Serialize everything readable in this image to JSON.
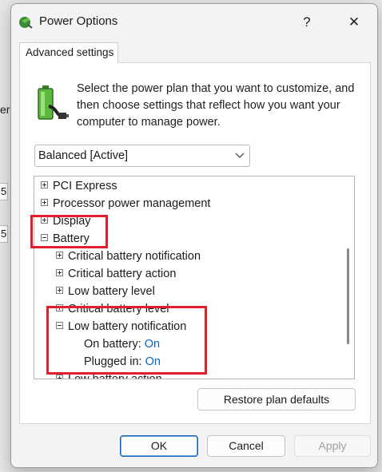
{
  "background": {
    "fragments": [
      "er",
      "5",
      "5"
    ]
  },
  "dialog": {
    "title": "Power Options",
    "help_label": "?",
    "close_label": "✕"
  },
  "tab": {
    "label": "Advanced settings"
  },
  "description": "Select the power plan that you want to customize, and then choose settings that reflect how you want your computer to manage power.",
  "plan_select": {
    "value": "Balanced [Active]"
  },
  "tree": {
    "rows": [
      {
        "label": "PCI Express",
        "expander": "plus"
      },
      {
        "label": "Processor power management",
        "expander": "plus"
      },
      {
        "label": "Display",
        "expander": "plus"
      },
      {
        "label": "Battery",
        "expander": "minus"
      },
      {
        "label": "Critical battery notification",
        "expander": "plus"
      },
      {
        "label": "Critical battery action",
        "expander": "plus"
      },
      {
        "label": "Low battery level",
        "expander": "plus"
      },
      {
        "label": "Critical battery level",
        "expander": "plus"
      },
      {
        "label": "Low battery notification",
        "expander": "minus"
      },
      {
        "label": "On battery:",
        "value": "On"
      },
      {
        "label": "Plugged in:",
        "value": "On"
      },
      {
        "label": "Low battery action",
        "expander": "plus"
      }
    ]
  },
  "restore_label": "Restore plan defaults",
  "footer": {
    "ok_label": "OK",
    "cancel_label": "Cancel",
    "apply_label": "Apply"
  },
  "colors": {
    "accent": "#0b62c4",
    "annotation": "#e01e2e"
  }
}
